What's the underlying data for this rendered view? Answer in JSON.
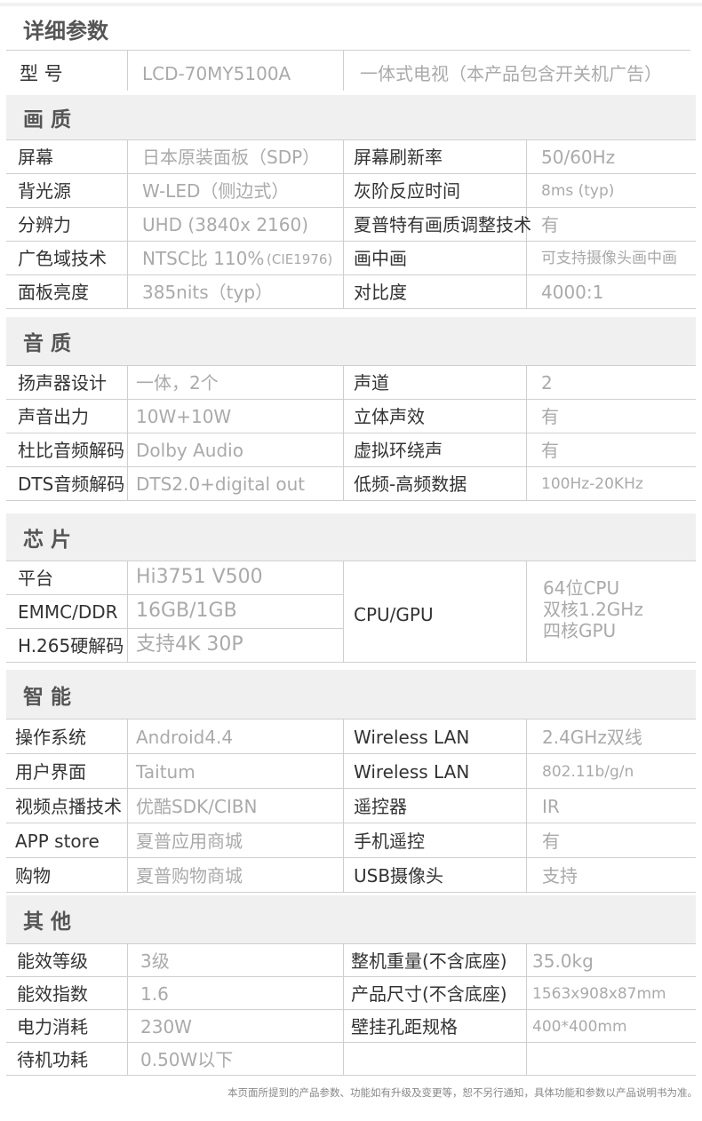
{
  "page_title": "详细参数",
  "model": {
    "label": "型 号",
    "value": "LCD-70MY5100A",
    "note": "一体式电视（本产品包含开关机广告）"
  },
  "picture": {
    "title": "画 质",
    "rows": [
      {
        "l1": "屏幕",
        "v1": "日本原装面板（SDP）",
        "l2": "屏幕刷新率",
        "v2": "50/60Hz"
      },
      {
        "l1": "背光源",
        "v1": "W-LED（侧边式）",
        "l2": "灰阶反应时间",
        "v2": "8ms (typ)"
      },
      {
        "l1": "分辨力",
        "v1": "UHD (3840x 2160)",
        "l2": "夏普特有画质调整技术",
        "v2": "有"
      },
      {
        "l1": "广色域技术",
        "v1": "NTSC比 110%",
        "v1b": "(CIE1976)",
        "l2": "画中画",
        "v2": "可支持摄像头画中画"
      },
      {
        "l1": "面板亮度",
        "v1": "385nits（typ）",
        "l2": "对比度",
        "v2": "4000:1"
      }
    ]
  },
  "sound": {
    "title": "音 质",
    "rows": [
      {
        "l1": "扬声器设计",
        "v1": "一体，2个",
        "l2": "声道",
        "v2": "2"
      },
      {
        "l1": "声音出力",
        "v1": "10W+10W",
        "l2": "立体声效",
        "v2": "有"
      },
      {
        "l1": "杜比音频解码",
        "v1": "Dolby Audio",
        "l2": "虚拟环绕声",
        "v2": "有"
      },
      {
        "l1": "DTS音频解码",
        "v1": "DTS2.0+digital out",
        "l2": "低频-高频数据",
        "v2": "100Hz-20KHz"
      }
    ]
  },
  "chip": {
    "title": "芯 片",
    "rows": [
      {
        "l1": "平台",
        "v1": "Hi3751 V500"
      },
      {
        "l1": "EMMC/DDR",
        "v1": "16GB/1GB"
      },
      {
        "l1": "H.265硬解码",
        "v1": "支持4K 30P"
      }
    ],
    "cpu_label": "CPU/GPU",
    "cpu_values": [
      "64位CPU",
      "双核1.2GHz",
      "四核GPU"
    ]
  },
  "smart": {
    "title": "智 能",
    "rows": [
      {
        "l1": "操作系统",
        "v1": "Android4.4",
        "l2": "Wireless LAN",
        "v2": "2.4GHz双线"
      },
      {
        "l1": "用户界面",
        "v1": "Taitum",
        "l2": "Wireless LAN",
        "v2": "802.11b/g/n"
      },
      {
        "l1": "视频点播技术",
        "v1": "优酷SDK/CIBN",
        "l2": "遥控器",
        "v2": "IR"
      },
      {
        "l1": "APP store",
        "v1": "夏普应用商城",
        "l2": "手机遥控",
        "v2": "有"
      },
      {
        "l1": "购物",
        "v1": "夏普购物商城",
        "l2": "USB摄像头",
        "v2": "支持"
      }
    ]
  },
  "other": {
    "title": "其 他",
    "rows": [
      {
        "l1": "能效等级",
        "v1": "3级",
        "l2": "整机重量(不含底座)",
        "v2": "35.0kg"
      },
      {
        "l1": "能效指数",
        "v1": "1.6",
        "l2": "产品尺寸(不含底座)",
        "v2": "1563x908x87mm"
      },
      {
        "l1": "电力消耗",
        "v1": "230W",
        "l2": "壁挂孔距规格",
        "v2": "400*400mm"
      },
      {
        "l1": "待机功耗",
        "v1": "0.50W以下",
        "l2": "",
        "v2": ""
      }
    ]
  },
  "footnote": "本页面所提到的产品参数、功能如有升级及变更等，恕不另行通知，具体功能和参数以产品说明书为准。"
}
